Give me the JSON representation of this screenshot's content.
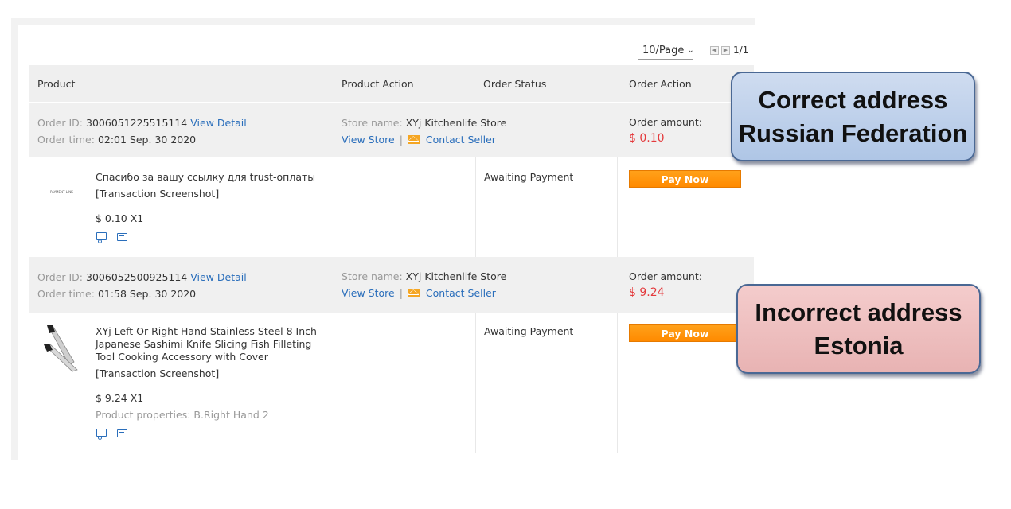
{
  "pager": {
    "per_page": "10/Page",
    "count": "1/1"
  },
  "columns": {
    "product": "Product",
    "product_action": "Product Action",
    "order_status": "Order Status",
    "order_action": "Order Action"
  },
  "labels": {
    "order_id": "Order ID:",
    "order_time": "Order time:",
    "view_detail": "View Detail",
    "store_name": "Store name:",
    "view_store": "View Store",
    "separator": "|",
    "contact_seller": "Contact Seller",
    "order_amount": "Order amount:",
    "pay_now": "Pay Now"
  },
  "orders": [
    {
      "id": "3006051225515114",
      "time": "02:01 Sep. 30 2020",
      "store": "XYj Kitchenlife Store",
      "amount": "$ 0.10",
      "product_name": "Спасибо за вашу ссылку для trust-оплаты",
      "screenshot_label": "[Transaction Screenshot]",
      "price_qty": "$ 0.10 X1",
      "thumb_text": "PAYMENT LINK",
      "status": "Awaiting Payment"
    },
    {
      "id": "3006052500925114",
      "time": "01:58 Sep. 30 2020",
      "store": "XYj Kitchenlife Store",
      "amount": "$ 9.24",
      "product_name": "XYj Left Or Right Hand Stainless Steel 8 Inch Japanese Sashimi Knife Slicing Fish Filleting Tool Cooking Accessory with Cover",
      "screenshot_label": "[Transaction Screenshot]",
      "price_qty": "$ 9.24 X1",
      "properties": "Product properties: B.Right Hand 2",
      "status": "Awaiting Payment"
    }
  ],
  "callouts": {
    "correct": {
      "line1": "Correct address",
      "line2": "Russian Federation"
    },
    "incorrect": {
      "line1": "Incorrect address",
      "line2": "Estonia"
    }
  },
  "colors": {
    "link": "#2a6ebb",
    "amount": "#e4393c",
    "pay_button": "#ff9500",
    "callout_blue": "#bfd1eb",
    "callout_red": "#eebfbf"
  }
}
